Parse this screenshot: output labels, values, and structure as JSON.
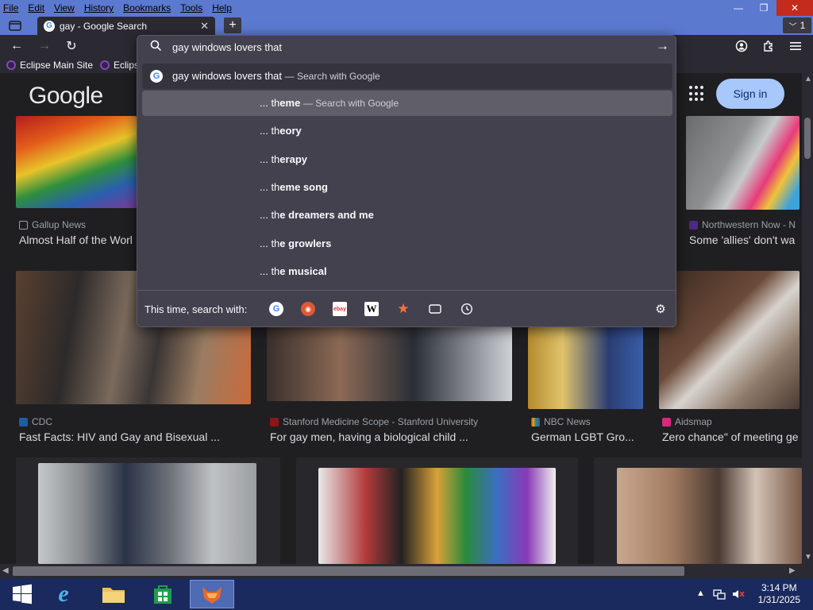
{
  "menubar": {
    "items": [
      "File",
      "Edit",
      "View",
      "History",
      "Bookmarks",
      "Tools",
      "Help"
    ]
  },
  "window": {
    "minimize": "—",
    "restore": "❐",
    "close": "✕"
  },
  "tabs": {
    "active_title": "gay - Google Search",
    "new_tab_label": "+",
    "tab_list_label": "1"
  },
  "toolbar": {
    "back": "←",
    "forward": "→",
    "reload": "↻"
  },
  "bookmarks": [
    {
      "label": "Eclipse Main Site"
    },
    {
      "label": "Eclips"
    }
  ],
  "google": {
    "logo": "Google",
    "sign_in": "Sign in"
  },
  "urlbar": {
    "query": "gay windows lovers that"
  },
  "suggestions": {
    "first": {
      "text": "gay windows lovers that",
      "hint": "— Search with Google"
    },
    "items": [
      {
        "prefix": "... th",
        "bold": "eme",
        "hint": "— Search with Google"
      },
      {
        "prefix": "... th",
        "bold": "eory",
        "hint": ""
      },
      {
        "prefix": "... th",
        "bold": "erapy",
        "hint": ""
      },
      {
        "prefix": "... th",
        "bold": "eme song",
        "hint": ""
      },
      {
        "prefix": "... th",
        "bold": "e dreamers and me",
        "hint": ""
      },
      {
        "prefix": "... th",
        "bold": "e growlers",
        "hint": ""
      },
      {
        "prefix": "... th",
        "bold": "e musical",
        "hint": ""
      }
    ]
  },
  "search_with": {
    "label": "This time, search with:",
    "engines": [
      "google-icon",
      "duckduckgo-icon",
      "ebay-icon",
      "wikipedia-icon",
      "bookmarks-star-icon",
      "tabs-icon",
      "history-icon"
    ],
    "ebay_text": "ebay",
    "wiki_text": "W"
  },
  "results": [
    {
      "source": "Gallup News",
      "title": "Almost Half of the Worl"
    },
    {
      "source": "Northwestern Now - N",
      "title": "Some 'allies' don't wa"
    },
    {
      "source": "CDC",
      "title": "Fast Facts: HIV and Gay and Bisexual ..."
    },
    {
      "source": "Stanford Medicine Scope - Stanford University",
      "title": "For gay men, having a biological child ..."
    },
    {
      "source": "NBC News",
      "title": "German LGBT Gro..."
    },
    {
      "source": "Aidsmap",
      "title": "Zero chance\" of meeting ge"
    }
  ],
  "taskbar": {
    "time": "3:14 PM",
    "date": "1/31/2025"
  },
  "colors": {
    "accent": "#5b79cf",
    "toolbar": "#2b2a33",
    "popup": "#42414d",
    "signin": "#a8c7fa"
  }
}
